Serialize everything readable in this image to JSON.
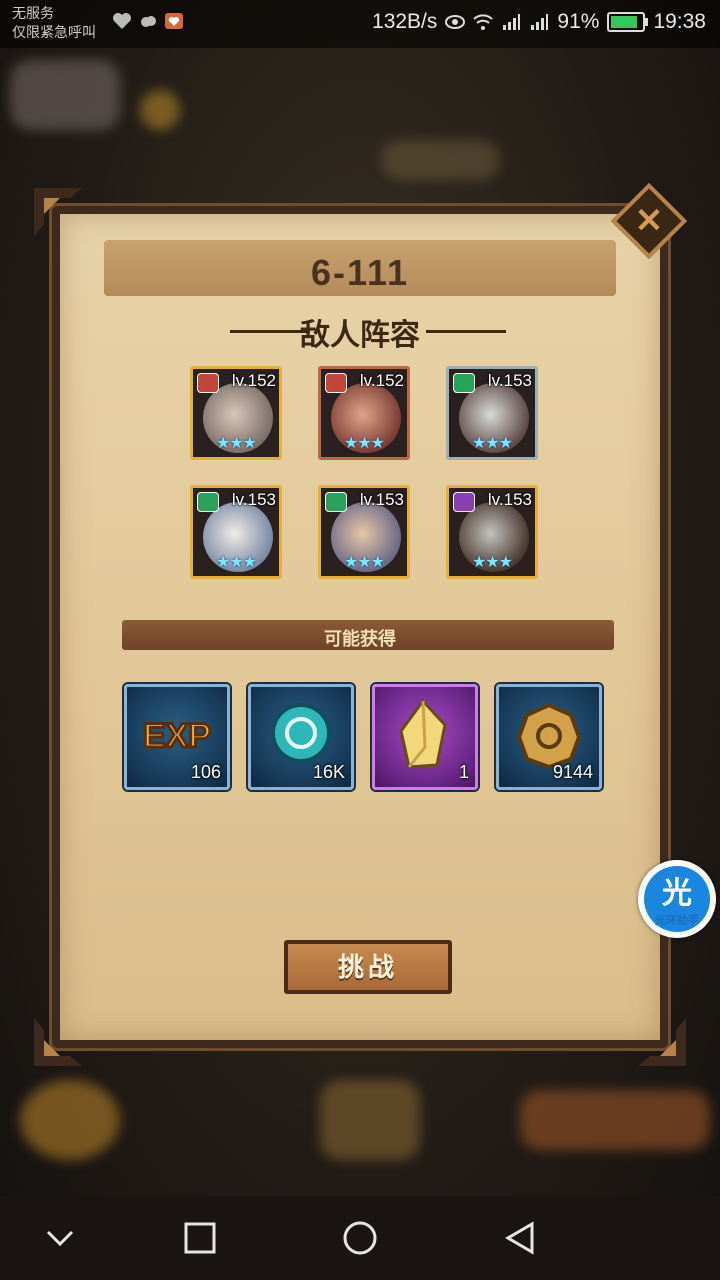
{
  "status_bar": {
    "carrier_line1": "无服务",
    "carrier_line2": "仅限紧急呼叫",
    "net_speed": "132B/s",
    "battery": "91%",
    "battery_level": 0.91,
    "time": "19:38"
  },
  "dialog": {
    "stage": "6-111",
    "enemy_section_title": "敌人阵容",
    "enemies": [
      {
        "level": "lv.152",
        "stars": "★★★",
        "element_color": "#c0463a",
        "frame": "gold"
      },
      {
        "level": "lv.152",
        "stars": "★★★",
        "element_color": "#c0463a",
        "frame": "red"
      },
      {
        "level": "lv.153",
        "stars": "★★★",
        "element_color": "#2aa35a",
        "frame": "silver"
      },
      {
        "level": "lv.153",
        "stars": "★★★",
        "element_color": "#2aa35a",
        "frame": "gold"
      },
      {
        "level": "lv.153",
        "stars": "★★★",
        "element_color": "#2aa35a",
        "frame": "gold"
      },
      {
        "level": "lv.153",
        "stars": "★★★",
        "element_color": "#8a3fb5",
        "frame": "gold"
      }
    ],
    "rewards_title": "可能获得",
    "rewards": [
      {
        "icon": "exp-icon",
        "count": "106"
      },
      {
        "icon": "orb-icon",
        "count": "16K"
      },
      {
        "icon": "crystal-icon",
        "count": "1"
      },
      {
        "icon": "coin-icon",
        "count": "9144"
      }
    ],
    "challenge_label": "挑战",
    "close_symbol": "✕"
  },
  "floating_assistant": {
    "glyph": "光",
    "label": "光环助手"
  },
  "colors": {
    "parchment": "#e2c898",
    "border_dark": "#3d2a1c",
    "button": "#b67640"
  }
}
